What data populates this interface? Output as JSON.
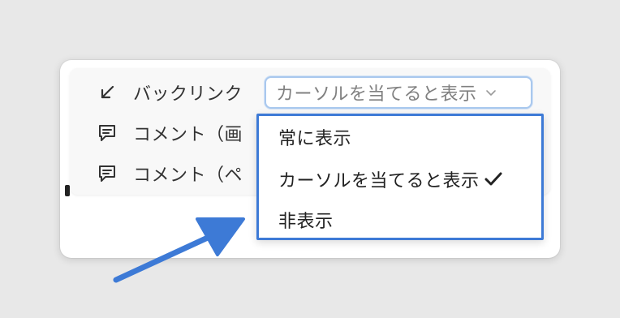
{
  "settings": {
    "backlinks": {
      "label": "バックリンク",
      "icon": "arrow-down-left-icon",
      "selected": "カーソルを当てると表示"
    },
    "comments_page_top": {
      "label": "コメント（画",
      "icon": "comment-icon"
    },
    "comments_page_side": {
      "label": "コメント（ペ",
      "icon": "comment-icon"
    }
  },
  "dropdown": {
    "options": [
      {
        "label": "常に表示",
        "checked": false
      },
      {
        "label": "カーソルを当てると表示",
        "checked": true
      },
      {
        "label": "非表示",
        "checked": false
      }
    ]
  },
  "colors": {
    "highlight_border": "#3d7ad6",
    "annotation_arrow": "#3d7ad6",
    "select_focus": "#a9c8ee"
  }
}
